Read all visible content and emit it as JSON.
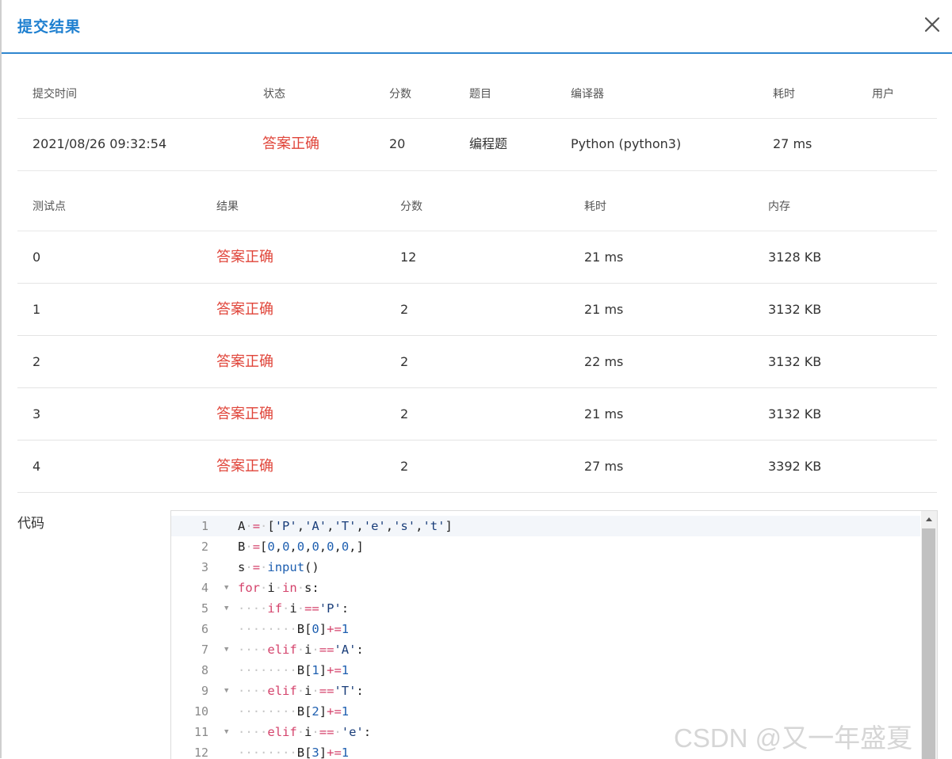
{
  "dialog": {
    "title": "提交结果",
    "close_icon": "close-icon",
    "accent_color": "#1f80d0"
  },
  "summary": {
    "headers": [
      "提交时间",
      "状态",
      "分数",
      "题目",
      "编译器",
      "耗时",
      "用户"
    ],
    "row": {
      "time": "2021/08/26 09:32:54",
      "status": "答案正确",
      "score": "20",
      "problem": "编程题",
      "compiler": "Python (python3)",
      "elapsed": "27 ms",
      "user": ""
    }
  },
  "testcases": {
    "headers": [
      "测试点",
      "结果",
      "分数",
      "耗时",
      "内存"
    ],
    "rows": [
      {
        "id": "0",
        "result": "答案正确",
        "score": "12",
        "time": "21 ms",
        "memory": "3128 KB"
      },
      {
        "id": "1",
        "result": "答案正确",
        "score": "2",
        "time": "21 ms",
        "memory": "3132 KB"
      },
      {
        "id": "2",
        "result": "答案正确",
        "score": "2",
        "time": "22 ms",
        "memory": "3132 KB"
      },
      {
        "id": "3",
        "result": "答案正确",
        "score": "2",
        "time": "21 ms",
        "memory": "3132 KB"
      },
      {
        "id": "4",
        "result": "答案正确",
        "score": "2",
        "time": "27 ms",
        "memory": "3392 KB"
      }
    ],
    "success_color": "#e0453a"
  },
  "code": {
    "label": "代码",
    "lines": [
      {
        "n": "1",
        "fold": false,
        "text": "A = ['P','A','T','e','s','t']"
      },
      {
        "n": "2",
        "fold": false,
        "text": "B =[0,0,0,0,0,0,]"
      },
      {
        "n": "3",
        "fold": false,
        "text": "s = input()"
      },
      {
        "n": "4",
        "fold": true,
        "text": "for i in s:"
      },
      {
        "n": "5",
        "fold": true,
        "text": "    if i =='P':"
      },
      {
        "n": "6",
        "fold": false,
        "text": "        B[0]+=1"
      },
      {
        "n": "7",
        "fold": true,
        "text": "    elif i =='A':"
      },
      {
        "n": "8",
        "fold": false,
        "text": "        B[1]+=1"
      },
      {
        "n": "9",
        "fold": true,
        "text": "    elif i =='T':"
      },
      {
        "n": "10",
        "fold": false,
        "text": "        B[2]+=1"
      },
      {
        "n": "11",
        "fold": true,
        "text": "    elif i == 'e':"
      },
      {
        "n": "12",
        "fold": false,
        "text": "        B[3]+=1"
      }
    ]
  },
  "watermark": "CSDN @又一年盛夏"
}
